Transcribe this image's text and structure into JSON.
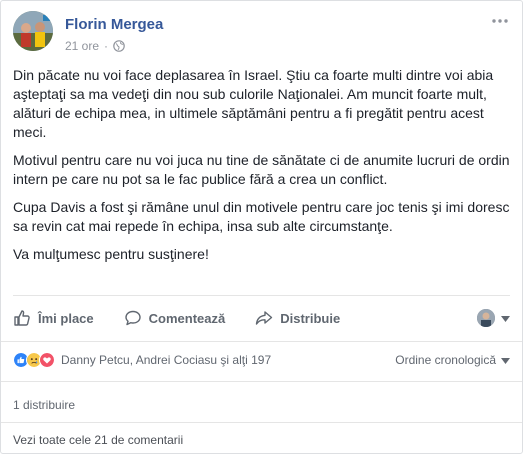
{
  "post": {
    "author": "Florin Mergea",
    "time": "21 ore",
    "paragraphs": [
      "Din păcate nu voi face deplasarea în Israel. Ştiu ca foarte multi dintre voi abia aşteptaţi sa ma vedeţi din nou sub culorile Naţionalei. Am muncit foarte mult, alături de echipa mea, in ultimele săptămâni pentru a fi pregătit pentru acest meci.",
      "Motivul pentru care nu voi juca nu tine de sănătate ci de anumite lucruri de ordin intern pe care nu pot sa le fac publice fără a crea un conflict.",
      "Cupa Davis a fost şi rămâne unul din motivele pentru care joc tenis şi imi doresc sa revin cat mai repede în echipa, insa sub alte circumstanţe.",
      "Va mulţumesc pentru susţinere!"
    ]
  },
  "actions": {
    "like": "Îmi place",
    "comment": "Comentează",
    "share": "Distribuie"
  },
  "reactions": {
    "names": "Danny Petcu, Andrei Cociasu şi alţi 197",
    "order": "Ordine cronologică",
    "icons": [
      "like-icon",
      "sad-icon",
      "love-icon"
    ]
  },
  "shares": "1 distribuire",
  "view_comments": "Vezi toate cele 21 de comentarii",
  "colors": {
    "author_blue": "#365899",
    "like_blue": "#2e83f8",
    "love_red": "#f25268",
    "sad_yellow": "#f7c84b",
    "muted": "#90949c",
    "action_gray": "#606770"
  }
}
